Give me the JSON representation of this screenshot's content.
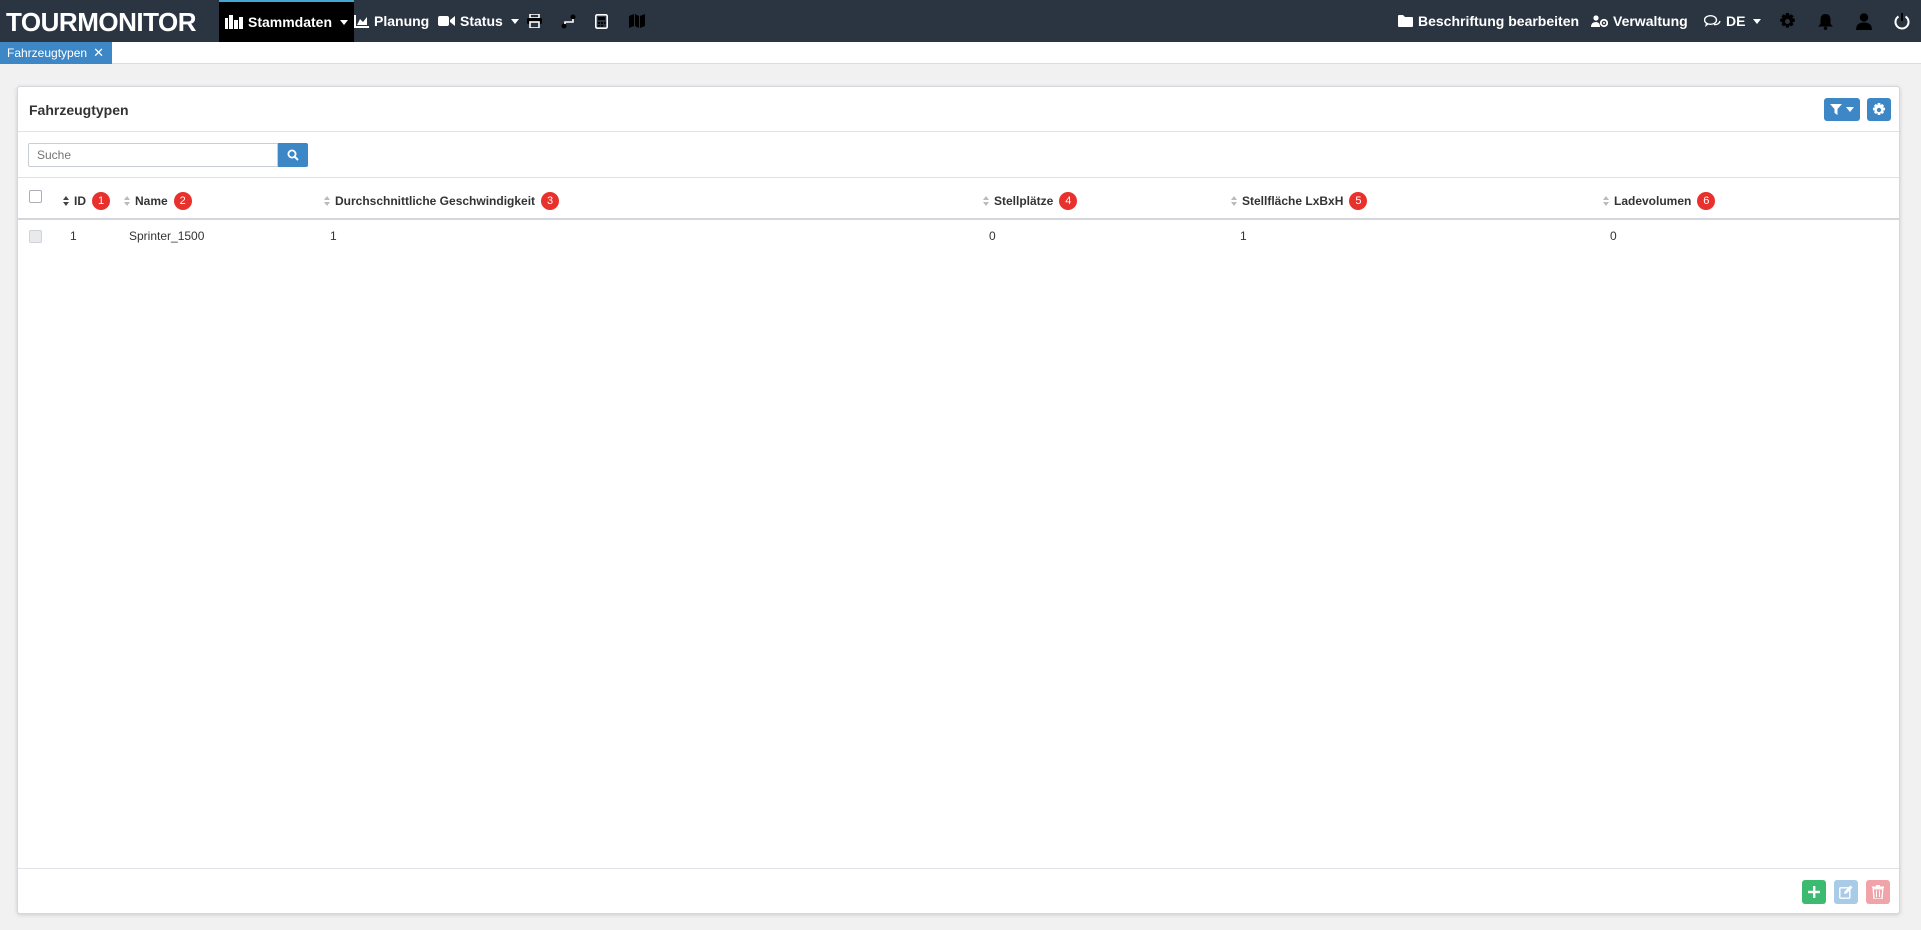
{
  "navbar": {
    "brand": "TOURMONITOR",
    "items": [
      {
        "label": "Stammdaten",
        "icon": "building-icon"
      },
      {
        "label": "Planung",
        "icon": "chart-area-icon"
      },
      {
        "label": "Status",
        "icon": "video-icon"
      }
    ],
    "right": {
      "edit_labels": "Beschriftung bearbeiten",
      "admin": "Verwaltung",
      "language": "DE"
    }
  },
  "tabs": [
    {
      "label": "Fahrzeugtypen"
    }
  ],
  "panel": {
    "title": "Fahrzeugtypen",
    "search_placeholder": "Suche"
  },
  "table": {
    "columns": [
      {
        "label": "ID",
        "badge": "1"
      },
      {
        "label": "Name",
        "badge": "2"
      },
      {
        "label": "Durchschnittliche Geschwindigkeit",
        "badge": "3"
      },
      {
        "label": "Stellplätze",
        "badge": "4"
      },
      {
        "label": "Stellfläche LxBxH",
        "badge": "5"
      },
      {
        "label": "Ladevolumen",
        "badge": "6"
      }
    ],
    "rows": [
      {
        "id": "1",
        "name": "Sprinter_1500",
        "speed": "1",
        "slots": "0",
        "area": "1",
        "volume": "0"
      }
    ]
  },
  "colors": {
    "navbar_bg": "#2b3541",
    "accent_blue": "#3d87c7",
    "badge_red": "#e8302c",
    "add_green": "#3cba6f",
    "delete_red": "#f0a4a9"
  }
}
